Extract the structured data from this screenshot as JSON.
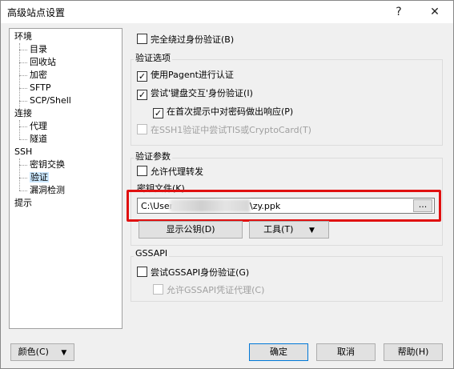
{
  "window": {
    "title": "高级站点设置",
    "help_label": "?",
    "close_label": "✕"
  },
  "tree": {
    "items": [
      {
        "label": "环境"
      },
      {
        "label": "目录"
      },
      {
        "label": "回收站"
      },
      {
        "label": "加密"
      },
      {
        "label": "SFTP"
      },
      {
        "label": "SCP/Shell"
      },
      {
        "label": "连接"
      },
      {
        "label": "代理"
      },
      {
        "label": "隧道"
      },
      {
        "label": "SSH"
      },
      {
        "label": "密钥交换"
      },
      {
        "label": "验证"
      },
      {
        "label": "漏洞检测"
      },
      {
        "label": "提示"
      }
    ]
  },
  "panel": {
    "bypass_auth": {
      "label": "完全绕过身份验证(B)",
      "checked": false
    },
    "auth_options": {
      "title": "验证选项",
      "use_pagent": {
        "label": "使用Pagent进行认证",
        "checked": true
      },
      "try_keyboard_interactive": {
        "label": "尝试'键盘交互'身份验证(I)",
        "checked": true
      },
      "respond_first_prompt": {
        "label": "在首次提示中对密码做出响应(P)",
        "checked": true
      },
      "try_tis": {
        "label": "在SSH1验证中尝试TIS或CryptoCard(T)",
        "checked": false
      }
    },
    "auth_params": {
      "title": "验证参数",
      "allow_agent_forwarding": {
        "label": "允许代理转发",
        "checked": false
      },
      "key_file_label": "密钥文件(K)",
      "key_file_prefix": "C:\\User",
      "key_file_suffix": "\\zy.ppk",
      "browse_label": "...",
      "show_pubkey_label": "显示公钥(D)",
      "tools_label": "工具(T)"
    },
    "gssapi": {
      "title": "GSSAPI",
      "try_gssapi": {
        "label": "尝试GSSAPI身份验证(G)",
        "checked": false
      },
      "allow_gssapi_delegation": {
        "label": "允许GSSAPI凭证代理(C)",
        "checked": false
      }
    }
  },
  "footer": {
    "color_label": "颜色(C)",
    "ok_label": "确定",
    "cancel_label": "取消",
    "help_label": "帮助(H)"
  },
  "icons": {
    "check": "✓",
    "dropdown": "▼"
  }
}
